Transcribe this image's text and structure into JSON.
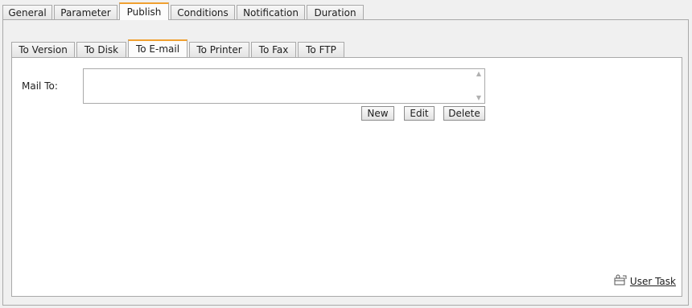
{
  "top_tabs": [
    {
      "label": "General"
    },
    {
      "label": "Parameter"
    },
    {
      "label": "Publish",
      "active": true
    },
    {
      "label": "Conditions"
    },
    {
      "label": "Notification"
    },
    {
      "label": "Duration"
    }
  ],
  "inner_tabs": [
    {
      "label": "To Version"
    },
    {
      "label": "To Disk"
    },
    {
      "label": "To E-mail",
      "active": true
    },
    {
      "label": "To Printer"
    },
    {
      "label": "To Fax"
    },
    {
      "label": "To FTP"
    }
  ],
  "mail_to": {
    "label": "Mail To:",
    "value": ""
  },
  "buttons": {
    "new": "New",
    "edit": "Edit",
    "delete": "Delete"
  },
  "user_task": {
    "label": "User Task",
    "icon": "user-task-icon"
  },
  "colors": {
    "active_tab_accent": "#f0a030",
    "panel_border": "#a9a9a9",
    "background": "#f0f0f0"
  }
}
